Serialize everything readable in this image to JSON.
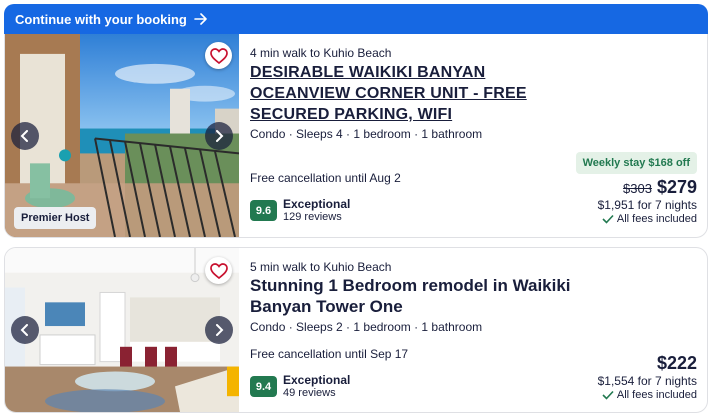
{
  "banner": {
    "label": "Continue with your booking",
    "icon": "arrow-right-icon"
  },
  "colors": {
    "brand": "#1668e3",
    "rating": "#227950",
    "deal_bg": "#e4f1e7",
    "heart": "#c8102e"
  },
  "listings": [
    {
      "walk": "4 min walk to Kuhio Beach",
      "title": "DESIRABLE WAIKIKI BANYAN OCEANVIEW CORNER UNIT - FREE SECURED PARKING, WIFI",
      "meta": "Condo · Sleeps 4 · 1 bedroom · 1 bathroom",
      "cancellation": "Free cancellation until Aug 2",
      "badge": "Premier Host",
      "deal": "Weekly stay $168 off",
      "old_price": "$303",
      "price": "$279",
      "total": "$1,951 for 7 nights",
      "fees": "All fees included",
      "score": "9.6",
      "rating_label": "Exceptional",
      "reviews": "129 reviews"
    },
    {
      "walk": "5 min walk to Kuhio Beach",
      "title": "Stunning 1 Bedroom remodel in Waikiki Banyan Tower One",
      "meta": "Condo · Sleeps 2 · 1 bedroom · 1 bathroom",
      "cancellation": "Free cancellation until Sep 17",
      "price": "$222",
      "total": "$1,554 for 7 nights",
      "fees": "All fees included",
      "score": "9.4",
      "rating_label": "Exceptional",
      "reviews": "49 reviews"
    }
  ]
}
